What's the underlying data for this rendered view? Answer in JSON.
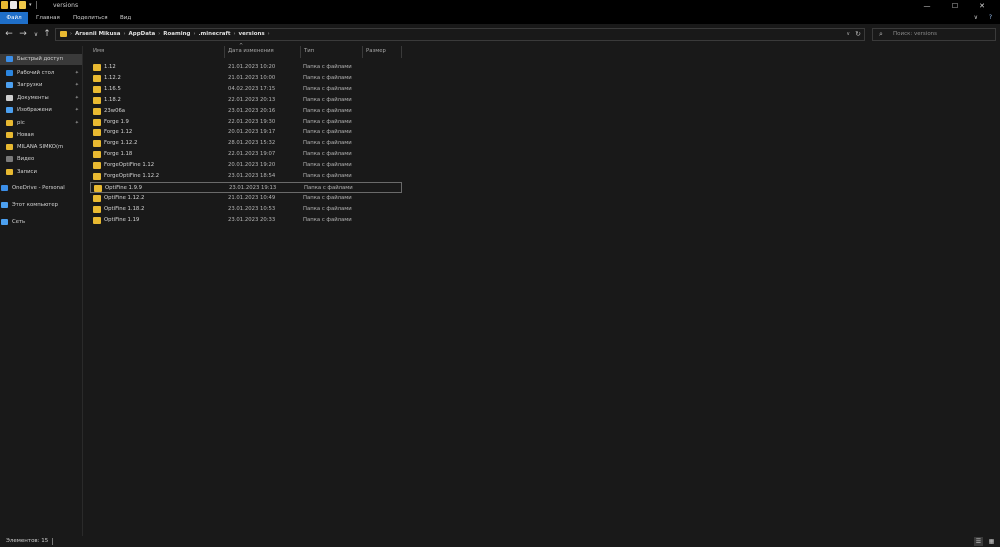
{
  "window": {
    "title": "versions",
    "controls": {
      "minimize": "—",
      "maximize": "☐",
      "close": "✕"
    }
  },
  "ribbon": {
    "tabs": [
      "Файл",
      "Главная",
      "Поделиться",
      "Вид"
    ],
    "expand": "∨",
    "help": "?"
  },
  "address": {
    "crumbs": [
      "Arsenii Mikusa",
      "AppData",
      "Roaming",
      ".minecraft",
      "versions"
    ],
    "search_placeholder": "Поиск: versions"
  },
  "nav": {
    "items": [
      {
        "label": "Быстрый доступ",
        "icon": "star-icon",
        "color": "#3b8ee8",
        "selected": true,
        "pinned": false
      },
      {
        "label": "Рабочий стол",
        "icon": "desktop-icon",
        "color": "#2b86e0",
        "selected": false,
        "pinned": true
      },
      {
        "label": "Загрузки",
        "icon": "download-icon",
        "color": "#4ca0f0",
        "selected": false,
        "pinned": true
      },
      {
        "label": "Документы",
        "icon": "document-icon",
        "color": "#cfcfcf",
        "selected": false,
        "pinned": true
      },
      {
        "label": "Изображени",
        "icon": "pictures-icon",
        "color": "#4ca0f0",
        "selected": false,
        "pinned": true
      },
      {
        "label": "pic",
        "icon": "folder-icon",
        "color": "#e8b931",
        "selected": false,
        "pinned": true
      },
      {
        "label": "Новая",
        "icon": "folder-icon",
        "color": "#e8b931",
        "selected": false,
        "pinned": false
      },
      {
        "label": "MILANA SIMKO(m",
        "icon": "folder-icon",
        "color": "#e8b931",
        "selected": false,
        "pinned": false
      },
      {
        "label": "Видео",
        "icon": "video-icon",
        "color": "#7a7a7a",
        "selected": false,
        "pinned": false
      },
      {
        "label": "Записи",
        "icon": "folder-icon",
        "color": "#e8b931",
        "selected": false,
        "pinned": false
      },
      {
        "label": "OneDrive - Personal",
        "icon": "onedrive-icon",
        "color": "#3b8ee8",
        "selected": false,
        "pinned": false
      },
      {
        "label": "Этот компьютер",
        "icon": "computer-icon",
        "color": "#4ca0f0",
        "selected": false,
        "pinned": false
      },
      {
        "label": "Сеть",
        "icon": "network-icon",
        "color": "#4ca0f0",
        "selected": false,
        "pinned": false
      }
    ]
  },
  "columns": {
    "name": "Имя",
    "date": "Дата изменения",
    "type": "Тип",
    "size": "Размер"
  },
  "files": [
    {
      "name": "1.12",
      "date": "21.01.2023 10:20",
      "type": "Папка с файлами"
    },
    {
      "name": "1.12.2",
      "date": "21.01.2023 10:00",
      "type": "Папка с файлами"
    },
    {
      "name": "1.16.5",
      "date": "04.02.2023 17:15",
      "type": "Папка с файлами"
    },
    {
      "name": "1.18.2",
      "date": "22.01.2023 20:13",
      "type": "Папка с файлами"
    },
    {
      "name": "23w06a",
      "date": "23.01.2023 20:16",
      "type": "Папка с файлами"
    },
    {
      "name": "Forge 1.9",
      "date": "22.01.2023 19:30",
      "type": "Папка с файлами"
    },
    {
      "name": "Forge 1.12",
      "date": "20.01.2023 19:17",
      "type": "Папка с файлами"
    },
    {
      "name": "Forge 1.12.2",
      "date": "28.01.2023 15:32",
      "type": "Папка с файлами"
    },
    {
      "name": "Forge 1.18",
      "date": "22.01.2023 19:07",
      "type": "Папка с файлами"
    },
    {
      "name": "ForgeOptiFine 1.12",
      "date": "20.01.2023 19:20",
      "type": "Папка с файлами"
    },
    {
      "name": "ForgeOptiFine 1.12.2",
      "date": "23.01.2023 18:54",
      "type": "Папка с файлами"
    },
    {
      "name": "OptiFine 1.9.9",
      "date": "23.01.2023 19:13",
      "type": "Папка с файлами",
      "focused": true
    },
    {
      "name": "OptiFine 1.12.2",
      "date": "21.01.2023 10:49",
      "type": "Папка с файлами"
    },
    {
      "name": "OptiFine 1.18.2",
      "date": "23.01.2023 10:53",
      "type": "Папка с файлами"
    },
    {
      "name": "OptiFine 1.19",
      "date": "23.01.2023 20:33",
      "type": "Папка с файлами"
    }
  ],
  "status": {
    "item_count": "Элементов: 15",
    "views": [
      "details-view-icon",
      "tiles-view-icon"
    ]
  }
}
